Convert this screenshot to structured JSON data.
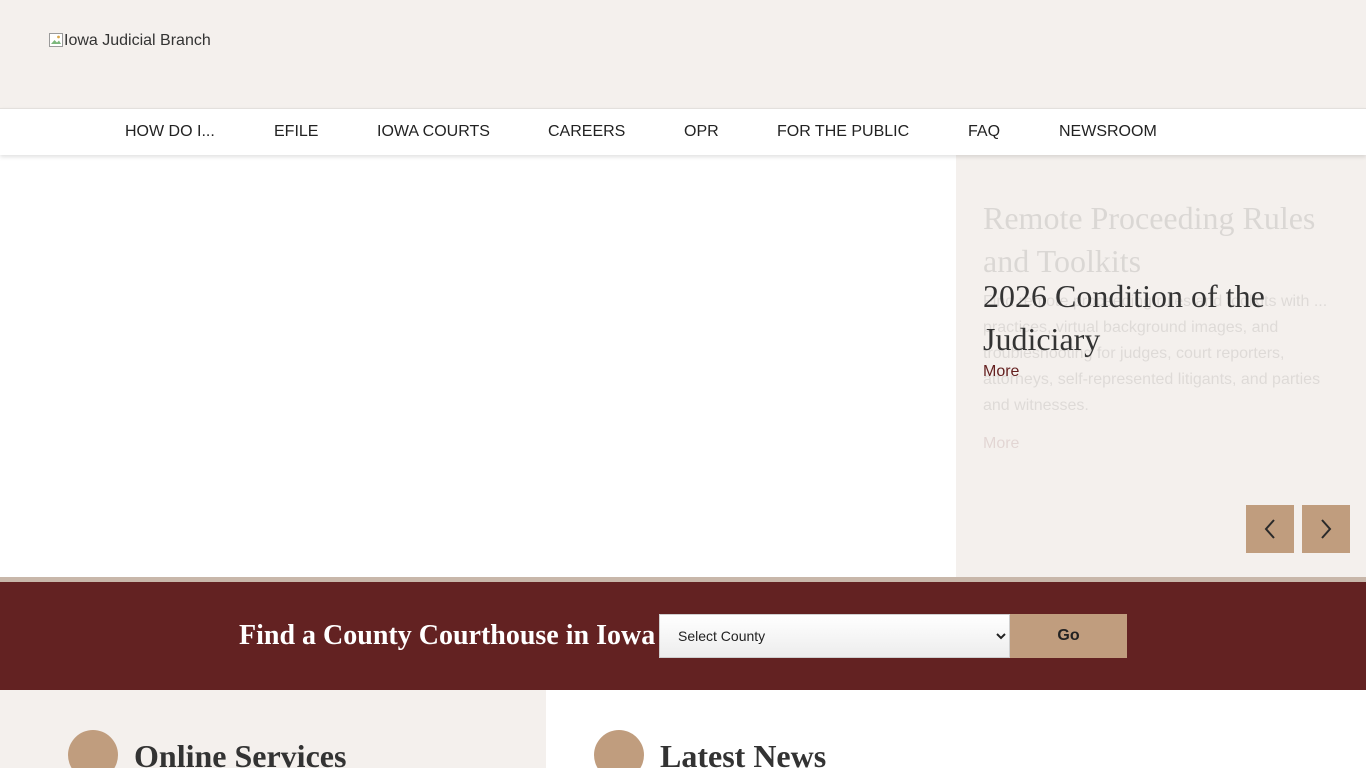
{
  "header": {
    "logo_alt": "Iowa Judicial Branch"
  },
  "nav": {
    "items": [
      {
        "label": "HOW DO I..."
      },
      {
        "label": "EFILE"
      },
      {
        "label": "IOWA COURTS"
      },
      {
        "label": "CAREERS"
      },
      {
        "label": "OPR"
      },
      {
        "label": "FOR THE PUBLIC"
      },
      {
        "label": "FAQ"
      },
      {
        "label": "NEWSROOM"
      }
    ]
  },
  "hero": {
    "previous_slide": {
      "title": "Remote Proceeding Rules and Toolkits",
      "text": "Find remote proceeding rules and toolkits with ... practices, virtual background images, and troubleshooting for judges, court reporters, attorneys, self-represented litigants, and parties and witnesses.",
      "more": "More"
    },
    "active_slide": {
      "title": "2026 Condition of the Judiciary",
      "more": "More"
    },
    "prev_icon": "chevron-left-icon",
    "next_icon": "chevron-right-icon"
  },
  "county_finder": {
    "title": "Find a County Courthouse in Iowa",
    "select_value": "Select County",
    "go_label": "Go"
  },
  "sections": {
    "online_services": {
      "title": "Online Services"
    },
    "latest_news": {
      "title": "Latest News"
    }
  },
  "colors": {
    "header_bg": "#f4f0ed",
    "accent_tan": "#c09d7e",
    "maroon": "#632222",
    "link_maroon": "#641f1f"
  }
}
